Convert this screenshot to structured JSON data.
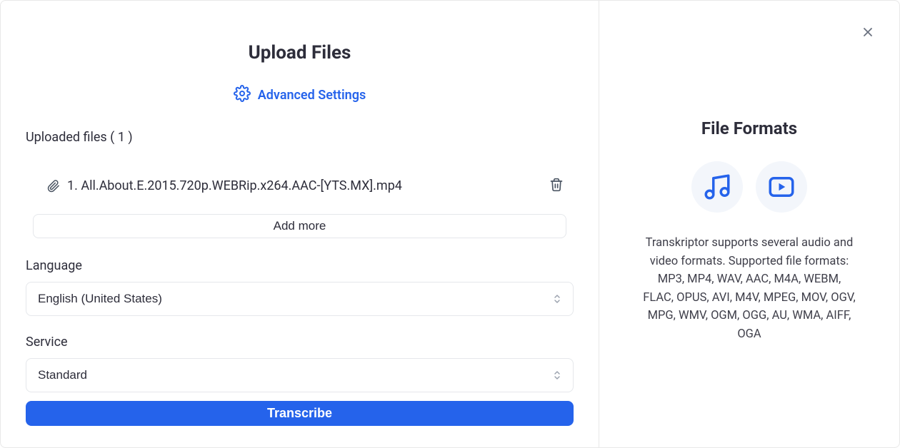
{
  "header": {
    "title": "Upload Files",
    "advanced_settings_label": "Advanced Settings"
  },
  "uploads": {
    "count": 1,
    "label_prefix": "Uploaded files",
    "files": [
      {
        "name": "1. All.About.E.2015.720p.WEBRip.x264.AAC-[YTS.MX].mp4"
      }
    ],
    "add_more_label": "Add more"
  },
  "fields": {
    "language_label": "Language",
    "language_value": "English (United States)",
    "service_label": "Service",
    "service_value": "Standard"
  },
  "actions": {
    "transcribe_label": "Transcribe"
  },
  "side": {
    "title": "File Formats",
    "description": "Transkriptor supports several audio and video formats. Supported file formats: MP3, MP4, WAV, AAC, M4A, WEBM, FLAC, OPUS, AVI, M4V, MPEG, MOV, OGV, MPG, WMV, OGM, OGG, AU, WMA, AIFF, OGA"
  },
  "icons": {
    "gear": "gear-icon",
    "attachment": "paperclip-icon",
    "music": "music-icon",
    "video": "video-icon",
    "trash": "trash-icon",
    "close": "close-icon"
  },
  "colors": {
    "accent": "#2563eb",
    "text": "#2d2d3a",
    "muted": "#6b7280",
    "border": "#e5e7eb"
  }
}
